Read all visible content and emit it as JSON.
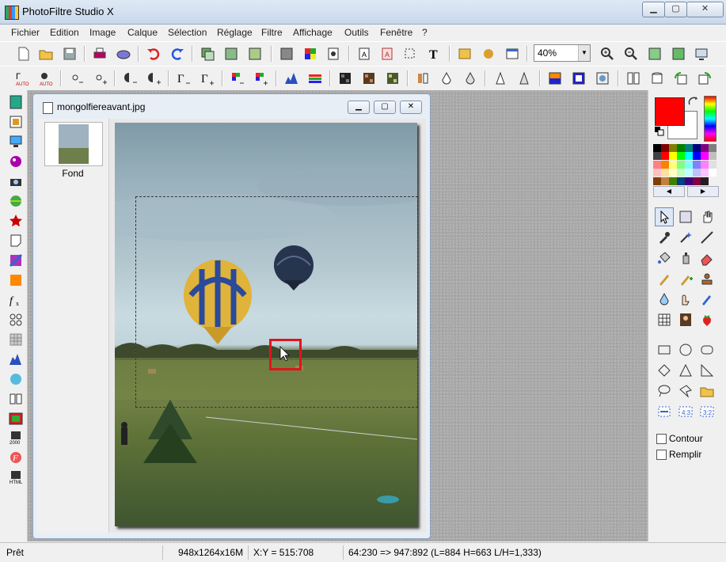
{
  "window": {
    "title": "PhotoFiltre Studio X",
    "minimize": "▭",
    "maximize": "▢",
    "close": "✕"
  },
  "menu": [
    "Fichier",
    "Edition",
    "Image",
    "Calque",
    "Sélection",
    "Réglage",
    "Filtre",
    "Affichage",
    "Outils",
    "Fenêtre",
    "?"
  ],
  "toolbar": {
    "zoom": "40%"
  },
  "document": {
    "title": "mongolfiereavant.jpg",
    "layer_name": "Fond"
  },
  "right_panel": {
    "contour_label": "Contour",
    "fill_label": "Remplir",
    "fg_color": "#ff0000",
    "bg_color": "#ffffff"
  },
  "status": {
    "state": "Prêt",
    "image_size": "948x1264x16M",
    "cursor": "X:Y = 515:708",
    "selection": "64:230 => 947:892 (L=884  H=663  L/H=1,333)"
  }
}
